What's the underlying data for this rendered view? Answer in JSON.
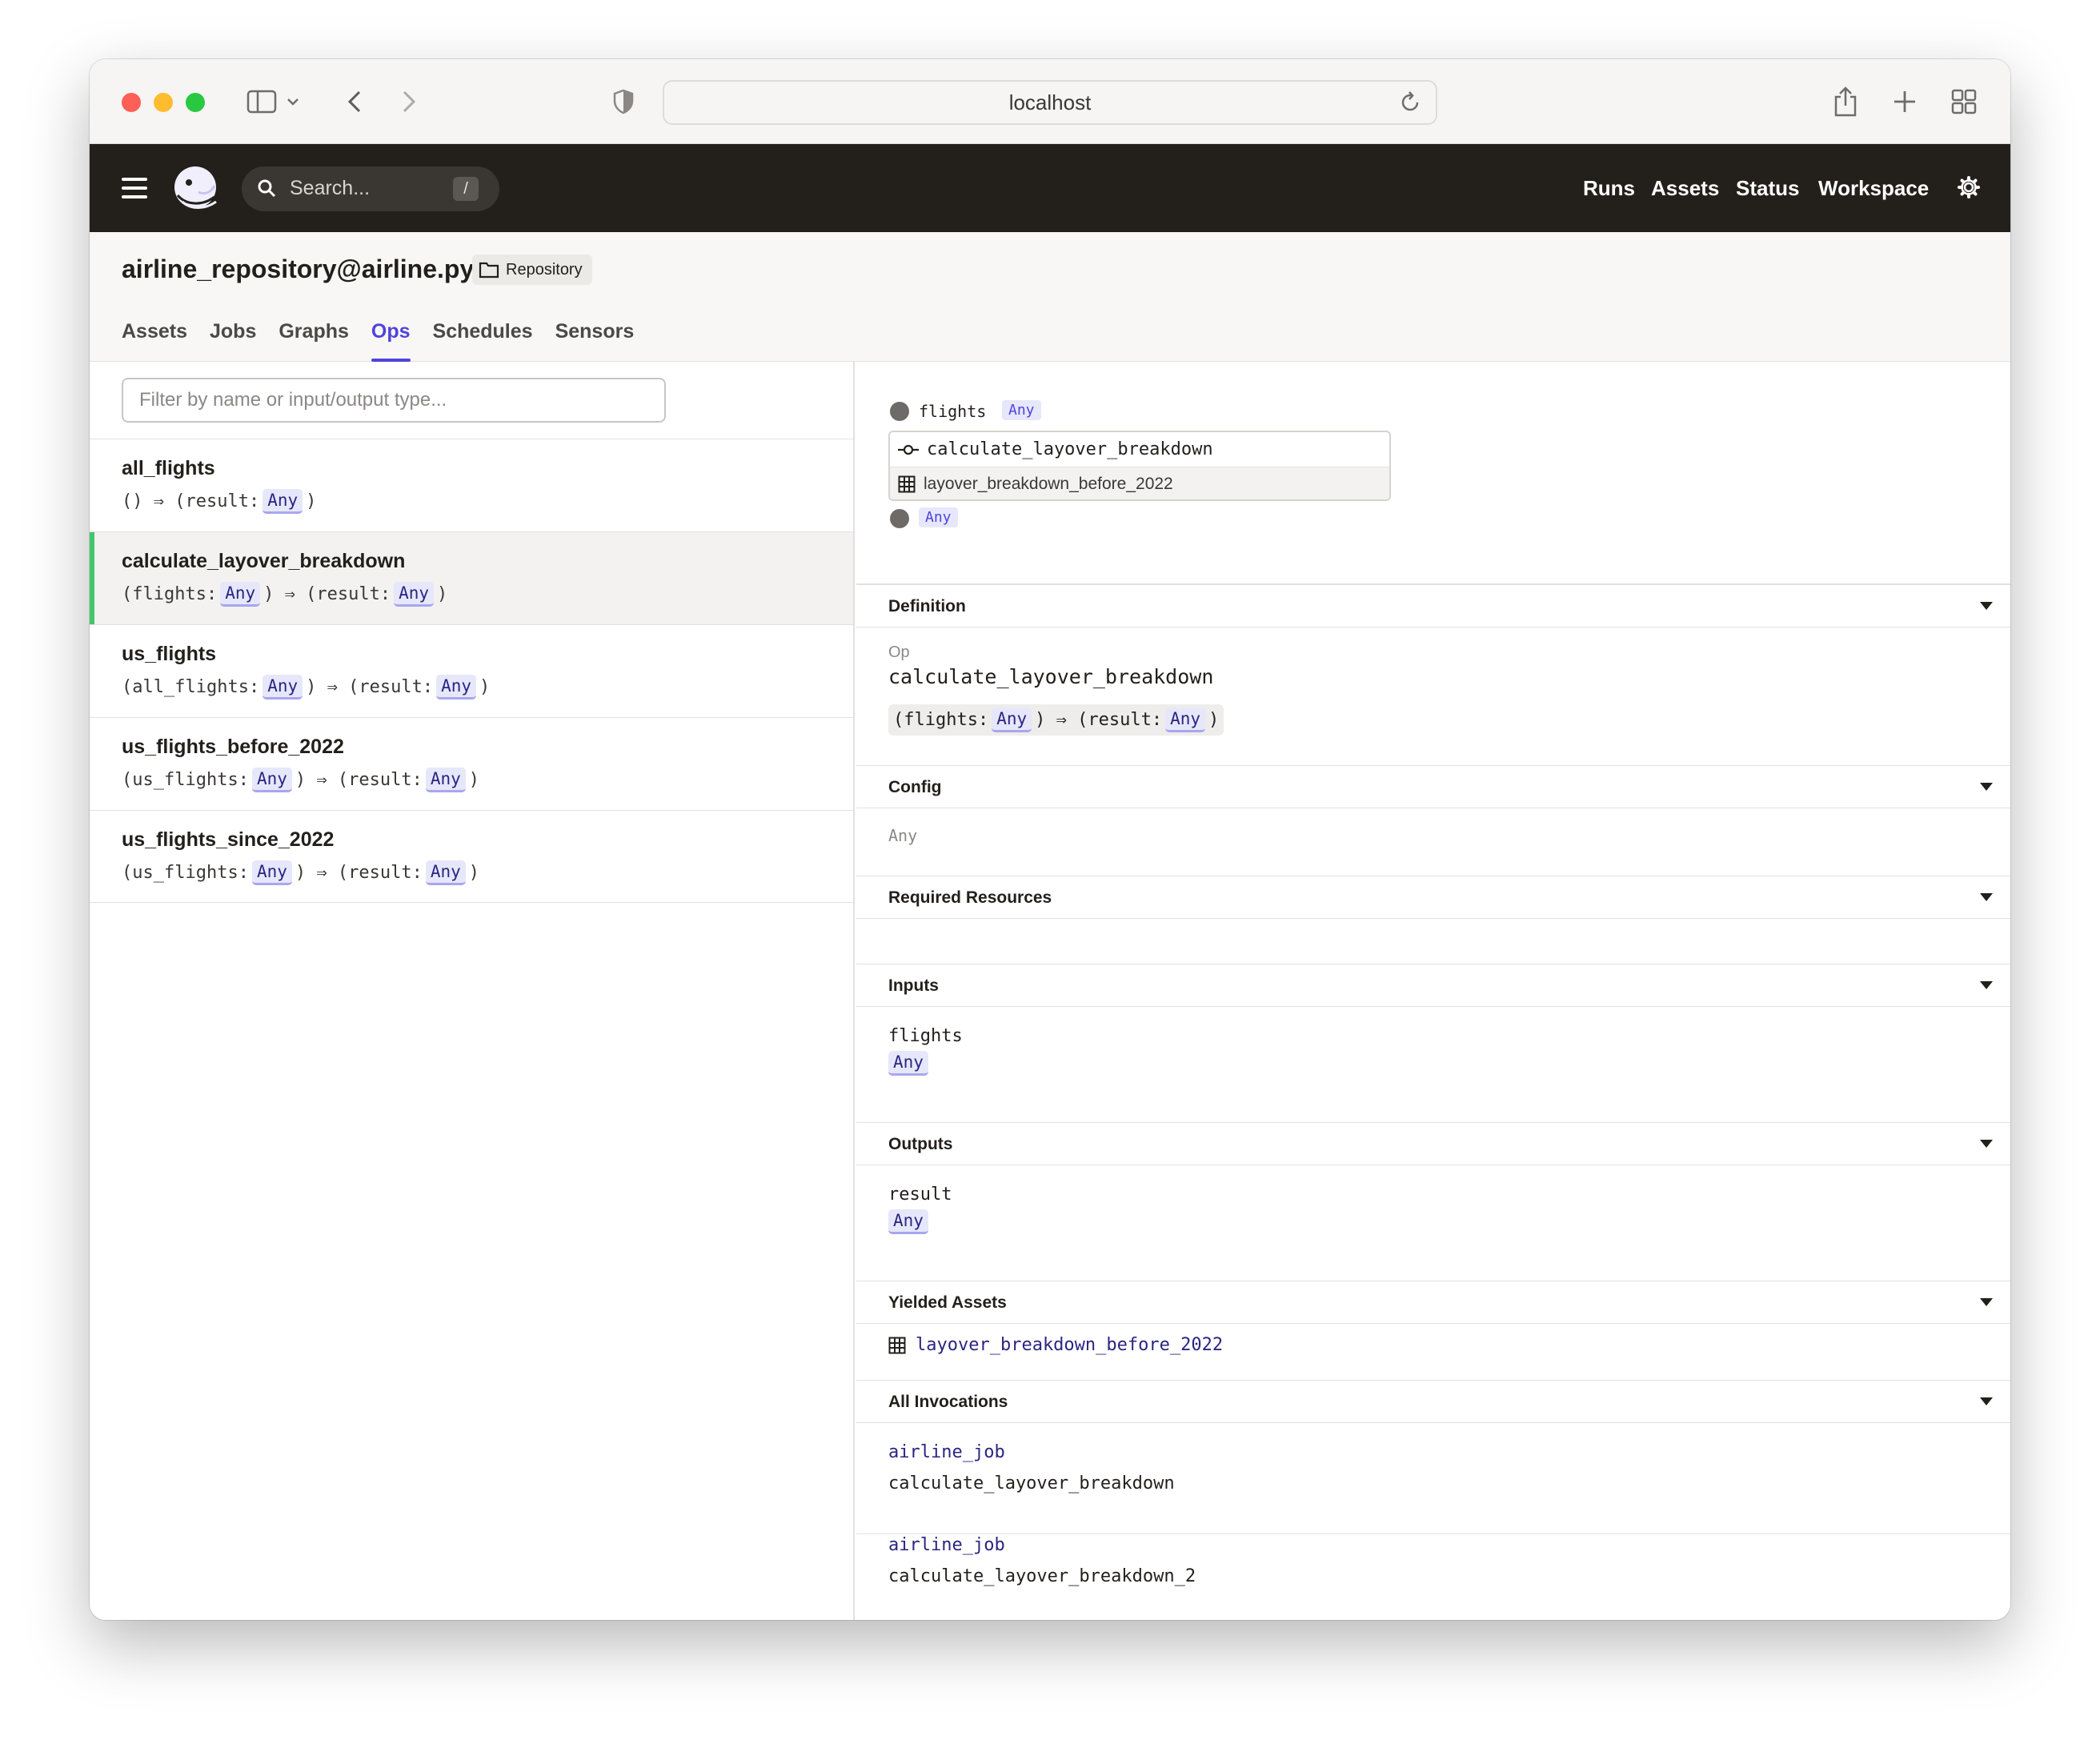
{
  "browser": {
    "url": "localhost"
  },
  "header": {
    "search_placeholder": "Search...",
    "search_shortcut": "/",
    "nav": [
      "Runs",
      "Assets",
      "Status",
      "Workspace"
    ]
  },
  "page": {
    "title": "airline_repository@airline.py",
    "tag": "Repository",
    "tabs": [
      "Assets",
      "Jobs",
      "Graphs",
      "Ops",
      "Schedules",
      "Sensors"
    ],
    "active_tab": "Ops"
  },
  "filter": {
    "placeholder": "Filter by name or input/output type..."
  },
  "ops": [
    {
      "name": "all_flights",
      "sig_pre": "() ⇒ (result:",
      "in_badge": "",
      "mid": "",
      "out_badge": "Any",
      "post": ")"
    },
    {
      "name": "calculate_layover_breakdown",
      "sig_pre": "(flights:",
      "in_badge": "Any",
      "mid": ") ⇒ (result:",
      "out_badge": "Any",
      "post": ")"
    },
    {
      "name": "us_flights",
      "sig_pre": "(all_flights:",
      "in_badge": "Any",
      "mid": ") ⇒ (result:",
      "out_badge": "Any",
      "post": ")"
    },
    {
      "name": "us_flights_before_2022",
      "sig_pre": "(us_flights:",
      "in_badge": "Any",
      "mid": ") ⇒ (result:",
      "out_badge": "Any",
      "post": ")"
    },
    {
      "name": "us_flights_since_2022",
      "sig_pre": "(us_flights:",
      "in_badge": "Any",
      "mid": ") ⇒ (result:",
      "out_badge": "Any",
      "post": ")"
    }
  ],
  "selected_op": "calculate_layover_breakdown",
  "graph": {
    "input_name": "flights",
    "input_type": "Any",
    "node_name": "calculate_layover_breakdown",
    "node_asset": "layover_breakdown_before_2022",
    "output_type": "Any"
  },
  "detail": {
    "definition": {
      "header": "Definition",
      "kind": "Op",
      "name": "calculate_layover_breakdown",
      "sig_pre": "(flights:",
      "in_badge": "Any",
      "mid": ") ⇒ (result:",
      "out_badge": "Any",
      "post": ")"
    },
    "config": {
      "header": "Config",
      "value": "Any"
    },
    "resources": {
      "header": "Required Resources"
    },
    "inputs": {
      "header": "Inputs",
      "name": "flights",
      "type": "Any"
    },
    "outputs": {
      "header": "Outputs",
      "name": "result",
      "type": "Any"
    },
    "yielded": {
      "header": "Yielded Assets",
      "asset": "layover_breakdown_before_2022"
    },
    "invocations": {
      "header": "All Invocations",
      "items": [
        {
          "job": "airline_job",
          "op": "calculate_layover_breakdown"
        },
        {
          "job": "airline_job",
          "op": "calculate_layover_breakdown_2"
        }
      ]
    }
  },
  "colors": {
    "accent": "#4f43dd",
    "selected_bar": "#43c66b",
    "header_bg": "#231f1b"
  }
}
